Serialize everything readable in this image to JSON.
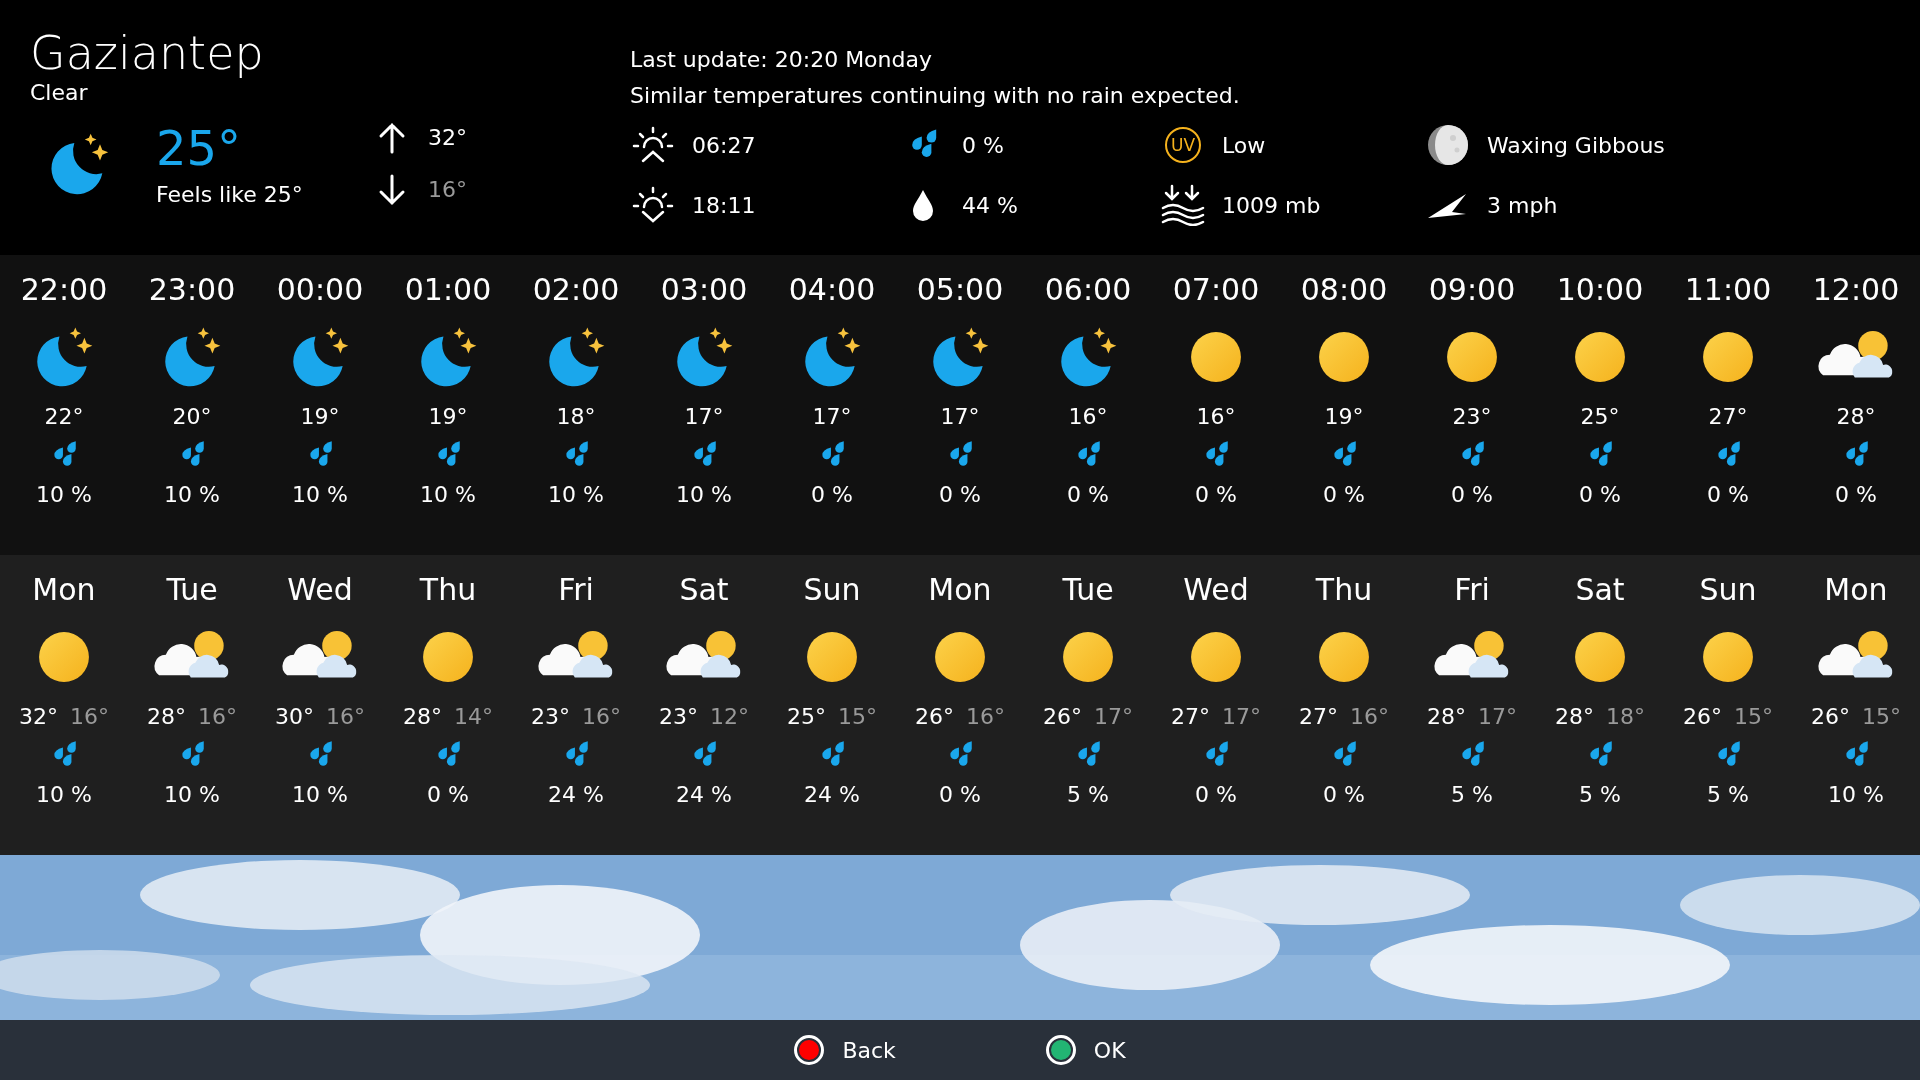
{
  "header": {
    "city": "Gaziantep",
    "condition": "Clear",
    "kind": "moon",
    "temperature": "25°",
    "feels_like": "Feels like 25°",
    "high": "32°",
    "low": "16°",
    "last_update": "Last update: 20:20 Monday",
    "summary": "Similar temperatures continuing with no rain expected.",
    "details": [
      {
        "kind": "sunrise",
        "value": "06:27"
      },
      {
        "kind": "rain",
        "value": "0 %"
      },
      {
        "kind": "uv",
        "badge": "UV",
        "value": "Low"
      },
      {
        "kind": "moon-phase",
        "value": "Waxing Gibbous"
      },
      {
        "kind": "sunset",
        "value": "18:11"
      },
      {
        "kind": "humidity",
        "value": "44 %"
      },
      {
        "kind": "pressure",
        "value": "1009 mb"
      },
      {
        "kind": "wind",
        "value": "3 mph"
      }
    ]
  },
  "hourly": [
    {
      "time": "22:00",
      "kind": "moon",
      "temp": "22°",
      "rain": "10 %"
    },
    {
      "time": "23:00",
      "kind": "moon",
      "temp": "20°",
      "rain": "10 %"
    },
    {
      "time": "00:00",
      "kind": "moon",
      "temp": "19°",
      "rain": "10 %"
    },
    {
      "time": "01:00",
      "kind": "moon",
      "temp": "19°",
      "rain": "10 %"
    },
    {
      "time": "02:00",
      "kind": "moon",
      "temp": "18°",
      "rain": "10 %"
    },
    {
      "time": "03:00",
      "kind": "moon",
      "temp": "17°",
      "rain": "10 %"
    },
    {
      "time": "04:00",
      "kind": "moon",
      "temp": "17°",
      "rain": "0 %"
    },
    {
      "time": "05:00",
      "kind": "moon",
      "temp": "17°",
      "rain": "0 %"
    },
    {
      "time": "06:00",
      "kind": "moon",
      "temp": "16°",
      "rain": "0 %"
    },
    {
      "time": "07:00",
      "kind": "sun",
      "temp": "16°",
      "rain": "0 %"
    },
    {
      "time": "08:00",
      "kind": "sun",
      "temp": "19°",
      "rain": "0 %"
    },
    {
      "time": "09:00",
      "kind": "sun",
      "temp": "23°",
      "rain": "0 %"
    },
    {
      "time": "10:00",
      "kind": "sun",
      "temp": "25°",
      "rain": "0 %"
    },
    {
      "time": "11:00",
      "kind": "sun",
      "temp": "27°",
      "rain": "0 %"
    },
    {
      "time": "12:00",
      "kind": "partly-cloudy",
      "temp": "28°",
      "rain": "0 %"
    }
  ],
  "daily": [
    {
      "day": "Mon",
      "kind": "sun",
      "high": "32°",
      "low": "16°",
      "rain": "10 %"
    },
    {
      "day": "Tue",
      "kind": "partly-cloudy",
      "high": "28°",
      "low": "16°",
      "rain": "10 %"
    },
    {
      "day": "Wed",
      "kind": "partly-cloudy",
      "high": "30°",
      "low": "16°",
      "rain": "10 %"
    },
    {
      "day": "Thu",
      "kind": "sun",
      "high": "28°",
      "low": "14°",
      "rain": "0 %"
    },
    {
      "day": "Fri",
      "kind": "partly-cloudy",
      "high": "23°",
      "low": "16°",
      "rain": "24 %"
    },
    {
      "day": "Sat",
      "kind": "partly-cloudy",
      "high": "23°",
      "low": "12°",
      "rain": "24 %"
    },
    {
      "day": "Sun",
      "kind": "sun",
      "high": "25°",
      "low": "15°",
      "rain": "24 %"
    },
    {
      "day": "Mon",
      "kind": "sun",
      "high": "26°",
      "low": "16°",
      "rain": "0 %"
    },
    {
      "day": "Tue",
      "kind": "sun",
      "high": "26°",
      "low": "17°",
      "rain": "5 %"
    },
    {
      "day": "Wed",
      "kind": "sun",
      "high": "27°",
      "low": "17°",
      "rain": "0 %"
    },
    {
      "day": "Thu",
      "kind": "sun",
      "high": "27°",
      "low": "16°",
      "rain": "0 %"
    },
    {
      "day": "Fri",
      "kind": "partly-cloudy",
      "high": "28°",
      "low": "17°",
      "rain": "5 %"
    },
    {
      "day": "Sat",
      "kind": "sun",
      "high": "28°",
      "low": "18°",
      "rain": "5 %"
    },
    {
      "day": "Sun",
      "kind": "sun",
      "high": "26°",
      "low": "15°",
      "rain": "5 %"
    },
    {
      "day": "Mon",
      "kind": "partly-cloudy",
      "high": "26°",
      "low": "15°",
      "rain": "10 %"
    }
  ],
  "buttons": [
    {
      "label": "Back",
      "color": "#ff0000"
    },
    {
      "label": "OK",
      "color": "#22b573"
    }
  ]
}
